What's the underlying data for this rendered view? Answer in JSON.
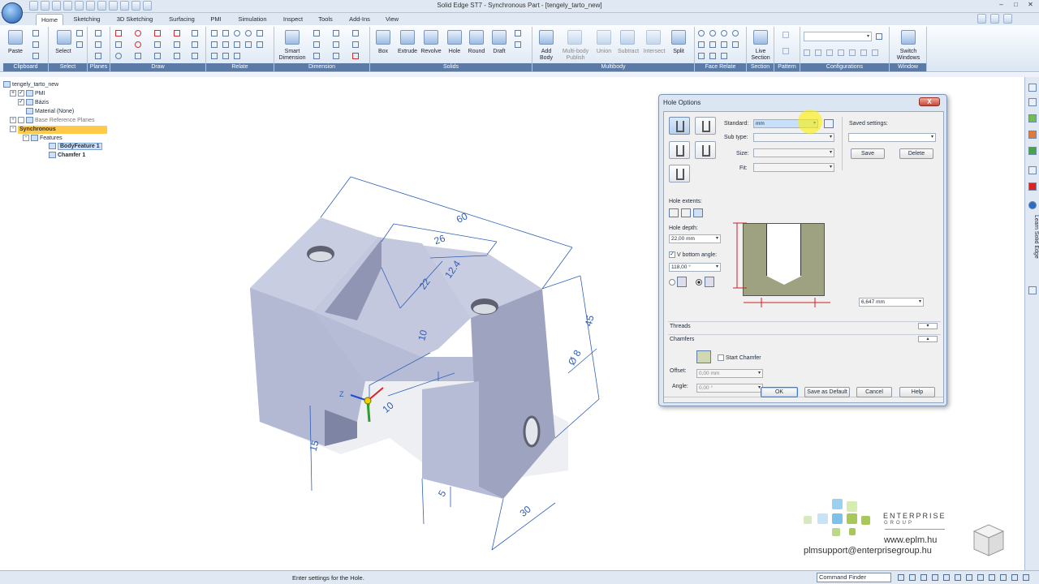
{
  "window": {
    "title": "Solid Edge ST7 - Synchronous Part - [tengely_tarto_new]",
    "min": "‒",
    "max": "□",
    "close": "✕"
  },
  "tabs": [
    "Home",
    "Sketching",
    "3D Sketching",
    "Surfacing",
    "PMI",
    "Simulation",
    "Inspect",
    "Tools",
    "Add-Ins",
    "View"
  ],
  "ribbon": {
    "groups": [
      "Clipboard",
      "Select",
      "Planes",
      "Draw",
      "Relate",
      "Dimension",
      "Solids",
      "Multibody",
      "Face Relate",
      "Section",
      "Pattern",
      "Configurations",
      "Window"
    ],
    "buttons": {
      "paste": "Paste",
      "select": "Select",
      "smart_dimension_1": "Smart",
      "smart_dimension_2": "Dimension",
      "box": "Box",
      "extrude": "Extrude",
      "revolve": "Revolve",
      "hole": "Hole",
      "round": "Round",
      "draft": "Draft",
      "add_body_1": "Add",
      "add_body_2": "Body",
      "multibody_1": "Multi-body",
      "multibody_2": "Publish",
      "union": "Union",
      "subtract": "Subtract",
      "intersect": "Intersect",
      "split": "Split",
      "live_section_1": "Live",
      "live_section_2": "Section",
      "switch_windows_1": "Switch",
      "switch_windows_2": "Windows"
    }
  },
  "tree": {
    "root": "tengely_tarto_new",
    "pmi": "PMI",
    "bazis": "Bázis",
    "material": "Material (None)",
    "base_ref": "Base Reference Planes",
    "synchronous": "Synchronous",
    "features": "Features",
    "body_feature": "BodyFeature 1",
    "chamfer": "Chamfer 1"
  },
  "model_dims": {
    "d60": "60",
    "d26": "26",
    "d22": "22",
    "d124": "12.4",
    "d45": "45",
    "d10a": "10",
    "d10b": "10",
    "d8": "Ø 8",
    "d15": "15",
    "d5": "5",
    "d30": "30",
    "axis_z": "Z"
  },
  "dialog": {
    "title": "Hole Options",
    "close": "X",
    "standard_label": "Standard:",
    "standard_value": "mm",
    "subtype_label": "Sub type:",
    "size_label": "Size:",
    "fit_label": "Fit:",
    "saved_settings_label": "Saved settings:",
    "save": "Save",
    "delete": "Delete",
    "hole_extents_label": "Hole extents:",
    "hole_depth_label": "Hole depth:",
    "hole_depth_value": "22,00 mm",
    "v_bottom_label": "V bottom angle:",
    "v_bottom_value": "118,00 °",
    "diagram_value": "6,647 mm",
    "threads": "Threads",
    "chamfers": "Chamfers",
    "start_chamfer": "Start Chamfer",
    "offset_label": "Offset:",
    "offset_value": "0,00 mm",
    "angle_label": "Angle:",
    "angle_value": "0,00 °",
    "ok": "OK",
    "save_default": "Save as Default",
    "cancel": "Cancel",
    "help": "Help"
  },
  "status": {
    "message": "Enter settings for the Hole.",
    "command_finder": "Command Finder"
  },
  "sidebar_right": {
    "learn": "Learn Solid Edge"
  },
  "branding": {
    "company": "ENTERPRISE",
    "group": "GROUP",
    "url": "www.eplm.hu",
    "email": "plmsupport@enterprisegroup.hu"
  },
  "colors": {
    "accent": "#5b7aa6",
    "model_face": "#b7bcd6",
    "dimension": "#2f5fb8",
    "highlight": "#ffc94a",
    "logo_blue": "#9bd0f0",
    "logo_green": "#a9c85a"
  }
}
